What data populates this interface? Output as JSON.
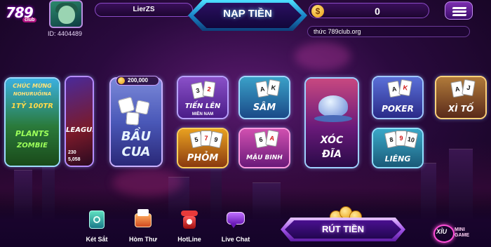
{
  "header": {
    "logo_number": "789",
    "logo_sub": "club",
    "user_name": "LierZS",
    "user_id": "ID: 4404489",
    "deposit_label": "NẠP TIỀN",
    "balance": "0",
    "coin_symbol": "$",
    "marquee_text": "thức 789club.org"
  },
  "jackpot": {
    "amount": "200,000"
  },
  "games": {
    "left_promo_1": "CHÚC MỪNG",
    "left_promo_2": "NOHURUỒINA",
    "left_promo_3": "1TỶ 100TR",
    "left_promo_4": "PLANTS",
    "left_promo_5": "ZOMBIE",
    "league_label": "LEAGUE",
    "league_num_1": "230",
    "league_num_2": "5,058",
    "bau_cua_1": "BẦU",
    "bau_cua_2": "CUA",
    "tien_len": "TIẾN LÊN",
    "tien_len_sub": "MIỀN NAM",
    "sam": "SÂM",
    "xoc_dia_1": "XÓC",
    "xoc_dia_2": "ĐĨA",
    "poker": "POKER",
    "xi_to": "XÌ TỐ",
    "phom": "PHỎM",
    "mau_binh": "MẬU BINH",
    "lieng": "LIÊNG"
  },
  "bottom_nav": {
    "items": [
      {
        "label": "Két Sắt",
        "icon": "safe-icon"
      },
      {
        "label": "Hòm Thư",
        "icon": "mailbox-icon"
      },
      {
        "label": "HotLine",
        "icon": "telephone-icon"
      },
      {
        "label": "Live Chat",
        "icon": "chat-bubble-icon"
      }
    ],
    "withdraw_label": "RÚT TIỀN",
    "minigame_short": "XỈU",
    "minigame_label_1": "MINI",
    "minigame_label_2": "GAME"
  },
  "colors": {
    "accent_blue": "#4ee0ff",
    "accent_purple": "#a456e8",
    "coin_gold": "#e89a10",
    "background": "#2a0a3e"
  }
}
